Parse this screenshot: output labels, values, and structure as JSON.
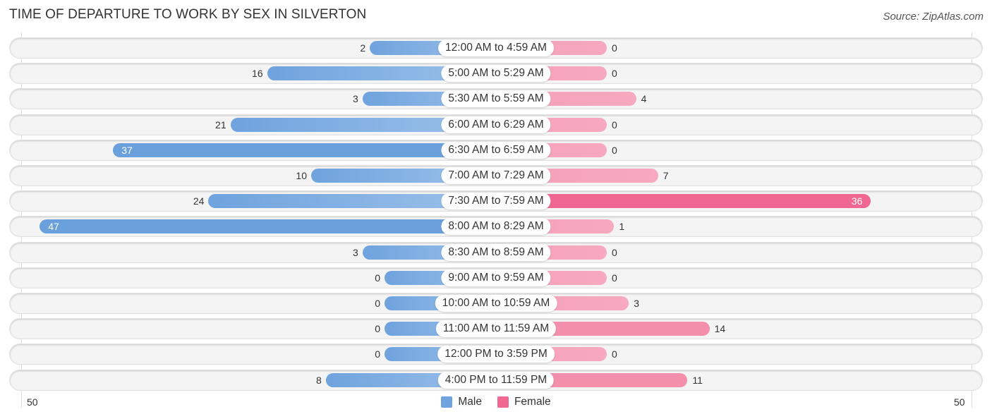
{
  "header": {
    "title": "TIME OF DEPARTURE TO WORK BY SEX IN SILVERTON",
    "source": "Source: ZipAtlas.com"
  },
  "colors": {
    "male": "#6fa3dd",
    "female": "#f06892",
    "male_light": "#9cc1ea",
    "female_light": "#f7a9bf"
  },
  "chart_data": {
    "type": "bar",
    "orientation": "horizontal-diverging",
    "title": "TIME OF DEPARTURE TO WORK BY SEX IN SILVERTON",
    "categories": [
      "12:00 AM to 4:59 AM",
      "5:00 AM to 5:29 AM",
      "5:30 AM to 5:59 AM",
      "6:00 AM to 6:29 AM",
      "6:30 AM to 6:59 AM",
      "7:00 AM to 7:29 AM",
      "7:30 AM to 7:59 AM",
      "8:00 AM to 8:29 AM",
      "8:30 AM to 8:59 AM",
      "9:00 AM to 9:59 AM",
      "10:00 AM to 10:59 AM",
      "11:00 AM to 11:59 AM",
      "12:00 PM to 3:59 PM",
      "4:00 PM to 11:59 PM"
    ],
    "series": [
      {
        "name": "Male",
        "values": [
          2,
          16,
          3,
          21,
          37,
          10,
          24,
          47,
          3,
          0,
          0,
          0,
          0,
          8
        ]
      },
      {
        "name": "Female",
        "values": [
          0,
          0,
          4,
          0,
          0,
          7,
          36,
          1,
          0,
          0,
          3,
          14,
          0,
          11
        ]
      }
    ],
    "axis": {
      "left_tick": "50",
      "right_tick": "50",
      "range": [
        -50,
        50
      ]
    },
    "legend": {
      "position": "bottom-center",
      "entries": [
        "Male",
        "Female"
      ]
    },
    "grid": false
  }
}
